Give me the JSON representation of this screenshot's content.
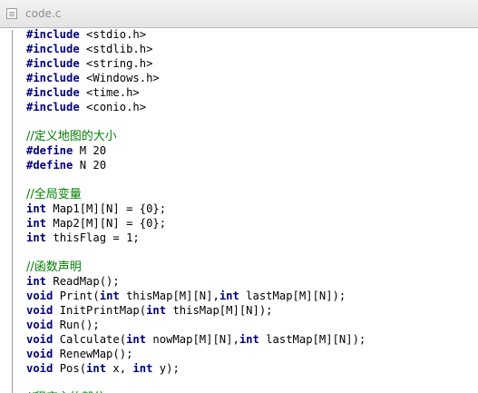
{
  "tab": {
    "title": "code.c"
  },
  "code_lines": [
    [
      {
        "t": "#include",
        "c": "kw-pp"
      },
      {
        "t": " <stdio.h>",
        "c": ""
      }
    ],
    [
      {
        "t": "#include",
        "c": "kw-pp"
      },
      {
        "t": " <stdlib.h>",
        "c": ""
      }
    ],
    [
      {
        "t": "#include",
        "c": "kw-pp"
      },
      {
        "t": " <string.h>",
        "c": ""
      }
    ],
    [
      {
        "t": "#include",
        "c": "kw-pp"
      },
      {
        "t": " <Windows.h>",
        "c": ""
      }
    ],
    [
      {
        "t": "#include",
        "c": "kw-pp"
      },
      {
        "t": " <time.h>",
        "c": ""
      }
    ],
    [
      {
        "t": "#include",
        "c": "kw-pp"
      },
      {
        "t": " <conio.h>",
        "c": ""
      }
    ],
    [],
    [
      {
        "t": "//定义地图的大小",
        "c": "cm"
      }
    ],
    [
      {
        "t": "#define",
        "c": "kw-pp"
      },
      {
        "t": " M 20",
        "c": ""
      }
    ],
    [
      {
        "t": "#define",
        "c": "kw-pp"
      },
      {
        "t": " N 20",
        "c": ""
      }
    ],
    [],
    [
      {
        "t": "//全局变量",
        "c": "cm"
      }
    ],
    [
      {
        "t": "int",
        "c": "kw"
      },
      {
        "t": " Map1[M][N] = {0};",
        "c": ""
      }
    ],
    [
      {
        "t": "int",
        "c": "kw"
      },
      {
        "t": " Map2[M][N] = {0};",
        "c": ""
      }
    ],
    [
      {
        "t": "int",
        "c": "kw"
      },
      {
        "t": " thisFlag = 1;",
        "c": ""
      }
    ],
    [],
    [
      {
        "t": "//函数声明",
        "c": "cm"
      }
    ],
    [
      {
        "t": "int",
        "c": "kw"
      },
      {
        "t": " ReadMap();",
        "c": ""
      }
    ],
    [
      {
        "t": "void",
        "c": "kw"
      },
      {
        "t": " Print(",
        "c": ""
      },
      {
        "t": "int",
        "c": "kw"
      },
      {
        "t": " thisMap[M][N],",
        "c": ""
      },
      {
        "t": "int",
        "c": "kw"
      },
      {
        "t": " lastMap[M][N]);",
        "c": ""
      }
    ],
    [
      {
        "t": "void",
        "c": "kw"
      },
      {
        "t": " InitPrintMap(",
        "c": ""
      },
      {
        "t": "int",
        "c": "kw"
      },
      {
        "t": " thisMap[M][N]);",
        "c": ""
      }
    ],
    [
      {
        "t": "void",
        "c": "kw"
      },
      {
        "t": " Run();",
        "c": ""
      }
    ],
    [
      {
        "t": "void",
        "c": "kw"
      },
      {
        "t": " Calculate(",
        "c": ""
      },
      {
        "t": "int",
        "c": "kw"
      },
      {
        "t": " nowMap[M][N],",
        "c": ""
      },
      {
        "t": "int",
        "c": "kw"
      },
      {
        "t": " lastMap[M][N]);",
        "c": ""
      }
    ],
    [
      {
        "t": "void",
        "c": "kw"
      },
      {
        "t": " RenewMap();",
        "c": ""
      }
    ],
    [
      {
        "t": "void",
        "c": "kw"
      },
      {
        "t": " Pos(",
        "c": ""
      },
      {
        "t": "int",
        "c": "kw"
      },
      {
        "t": " x, ",
        "c": ""
      },
      {
        "t": "int",
        "c": "kw"
      },
      {
        "t": " y);",
        "c": ""
      }
    ],
    [],
    [
      {
        "t": "//程序主体部分",
        "c": "cm"
      }
    ]
  ]
}
